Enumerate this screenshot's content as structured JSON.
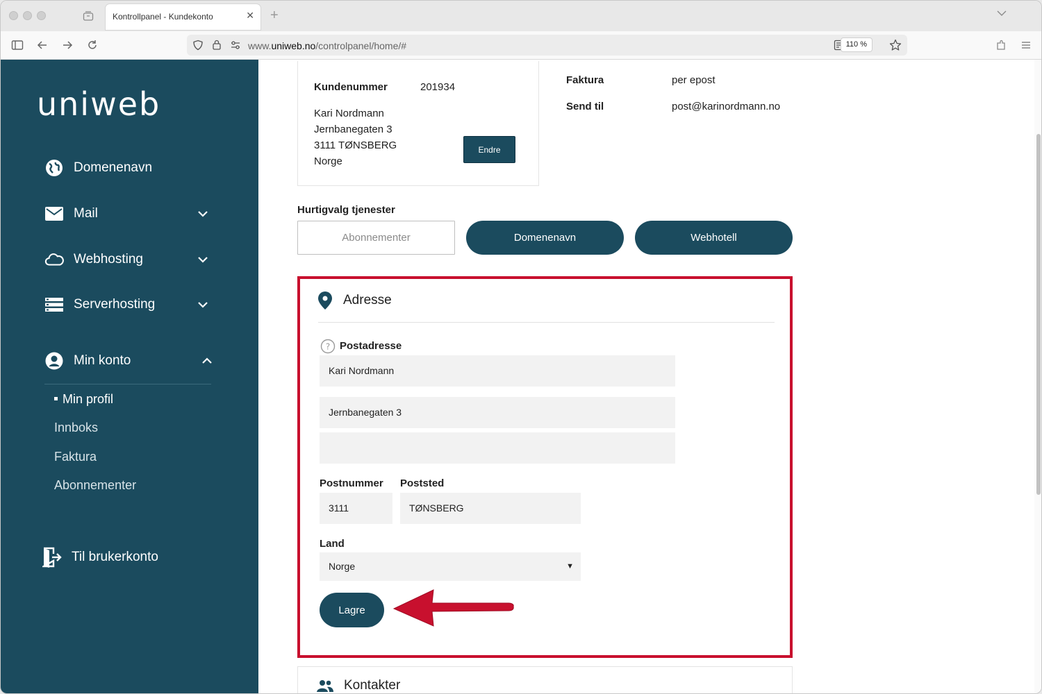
{
  "browser": {
    "tab_title": "Kontrollpanel - Kundekonto",
    "url_prefix": "www.",
    "url_domain": "uniweb.no",
    "url_path": "/controlpanel/home/#",
    "zoom": "110 %"
  },
  "sidebar": {
    "logo_text": "uniweb",
    "items": [
      {
        "label": "Domenenavn",
        "icon": "globe-icon"
      },
      {
        "label": "Mail",
        "icon": "envelope-icon",
        "expandable": true
      },
      {
        "label": "Webhosting",
        "icon": "cloud-icon",
        "expandable": true
      },
      {
        "label": "Serverhosting",
        "icon": "server-icon",
        "expandable": true
      },
      {
        "label": "Min konto",
        "icon": "user-circle-icon",
        "expanded": true
      }
    ],
    "sub_items": [
      {
        "label": "Min profil",
        "active": true
      },
      {
        "label": "Innboks"
      },
      {
        "label": "Faktura"
      },
      {
        "label": "Abonnementer"
      }
    ],
    "footer_link": "Til brukerkonto"
  },
  "customer": {
    "number_label": "Kundenummer",
    "number": "201934",
    "address_lines": [
      "Kari Nordmann",
      "Jernbanegaten 3",
      "3111 TØNSBERG",
      "Norge"
    ],
    "edit_button": "Endre"
  },
  "invoice": {
    "faktura_label": "Faktura",
    "faktura_value": "per epost",
    "send_label": "Send til",
    "send_value": "post@karinordmann.no"
  },
  "quick": {
    "title": "Hurtigvalg tjenester",
    "buttons": [
      "Abonnementer",
      "Domenenavn",
      "Webhotell"
    ]
  },
  "address_form": {
    "title": "Adresse",
    "postal_label": "Postadresse",
    "line1": "Kari Nordmann",
    "line2": "Jernbanegaten 3",
    "line3": "",
    "postnr_label": "Postnummer",
    "postnr": "3111",
    "poststed_label": "Poststed",
    "poststed": "TØNSBERG",
    "country_label": "Land",
    "country": "Norge",
    "save_button": "Lagre"
  },
  "contacts": {
    "title": "Kontakter"
  },
  "colors": {
    "brand": "#1b4b5e",
    "highlight": "#c8102e"
  }
}
